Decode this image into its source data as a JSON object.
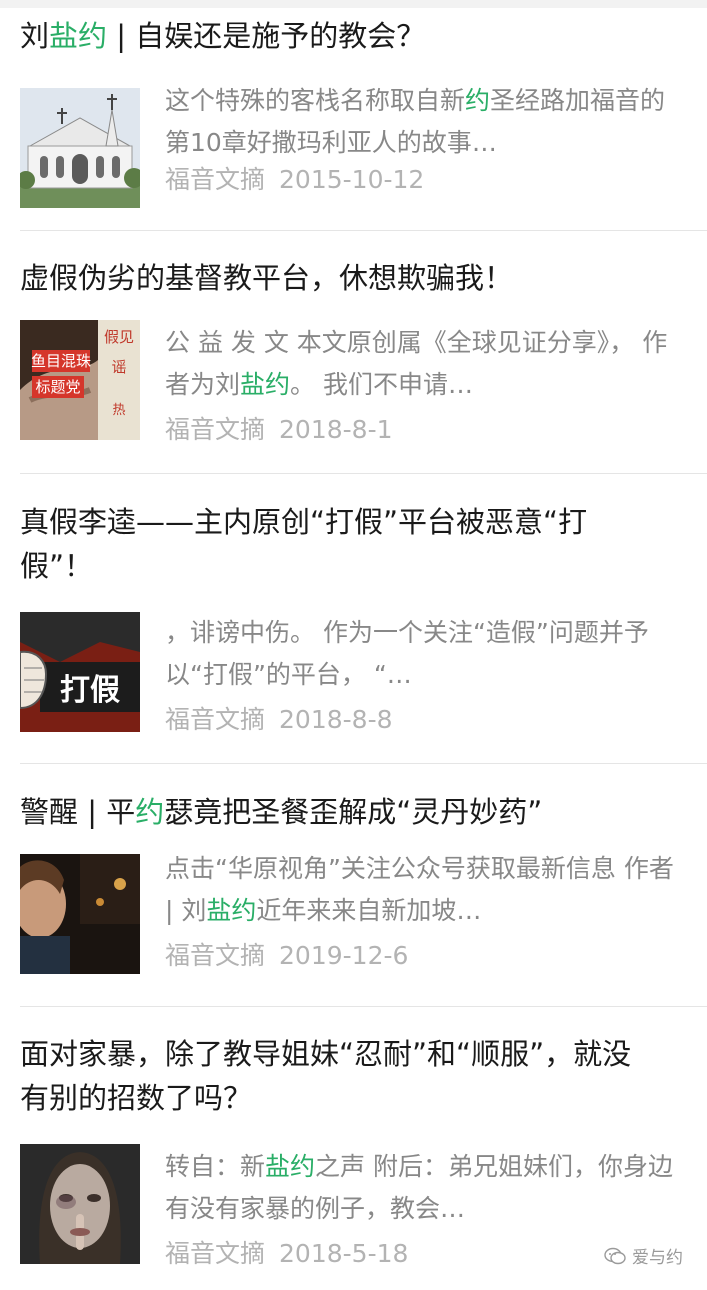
{
  "articles": [
    {
      "title_parts": [
        {
          "text": "刘",
          "hl": false
        },
        {
          "text": "盐约",
          "hl": true
        },
        {
          "text": " | 自娱还是施予的教会？",
          "hl": false
        }
      ],
      "summary_parts": [
        {
          "text": "这个特殊的客栈名称取自新",
          "hl": false
        },
        {
          "text": "约",
          "hl": true
        },
        {
          "text": "圣经路加福音的第10章好撒玛利亚人的故事…",
          "hl": false
        }
      ],
      "source": "福音文摘",
      "date": "2015-10-12",
      "thumb": "church-building-image"
    },
    {
      "title_parts": [
        {
          "text": "虚假伪劣的基督教平台，休想欺骗我！",
          "hl": false
        }
      ],
      "summary_parts": [
        {
          "text": "公 益 发 文 本文原创属《全球见证分享》， 作者为刘",
          "hl": false
        },
        {
          "text": "盐约",
          "hl": true
        },
        {
          "text": "。 我们不申请…",
          "hl": false
        }
      ],
      "source": "福音文摘",
      "date": "2018-8-1",
      "thumb": "fake-news-poster-image",
      "thumb_text": [
        "鱼目混珠",
        "标题党",
        "假见",
        "谣",
        "热"
      ]
    },
    {
      "title_parts": [
        {
          "text": "真假李逵——主内原创“打假”平台被恶意“打假”！",
          "hl": false
        }
      ],
      "summary_parts": [
        {
          "text": "，诽谤中伤。 作为一个关注“造假”问题并予以“打假”的平台， “…",
          "hl": false
        }
      ],
      "source": "福音文摘",
      "date": "2018-8-8",
      "thumb": "fist-anti-fake-image",
      "thumb_text": [
        "打假"
      ]
    },
    {
      "title_parts": [
        {
          "text": "警醒 | 平",
          "hl": false
        },
        {
          "text": "约",
          "hl": true
        },
        {
          "text": "瑟竟把圣餐歪解成“灵丹妙药”",
          "hl": false
        }
      ],
      "summary_parts": [
        {
          "text": "点击“华原视角”关注公众号获取最新信息 作者 | 刘",
          "hl": false
        },
        {
          "text": "盐约",
          "hl": true
        },
        {
          "text": "近年来来自新加坡…",
          "hl": false
        }
      ],
      "source": "福音文摘",
      "date": "2019-12-6",
      "thumb": "preacher-portrait-image"
    },
    {
      "title_parts": [
        {
          "text": "面对家暴，除了教导姐妹“忍耐”和“顺服”，就没有别的招数了吗？",
          "hl": false
        }
      ],
      "summary_parts": [
        {
          "text": "转自：新",
          "hl": false
        },
        {
          "text": "盐约",
          "hl": true
        },
        {
          "text": "之声 附后：弟兄姐妹们，你身边有没有家暴的例子，教会…",
          "hl": false
        }
      ],
      "source": "福音文摘",
      "date": "2018-5-18",
      "thumb": "bruised-woman-image"
    }
  ],
  "watermark": {
    "label": "爱与约",
    "icon": "wechat-icon"
  },
  "colors": {
    "highlight": "#2aae67",
    "summary": "#888888",
    "meta": "#b3b3b3",
    "title": "#1a1a1a"
  }
}
